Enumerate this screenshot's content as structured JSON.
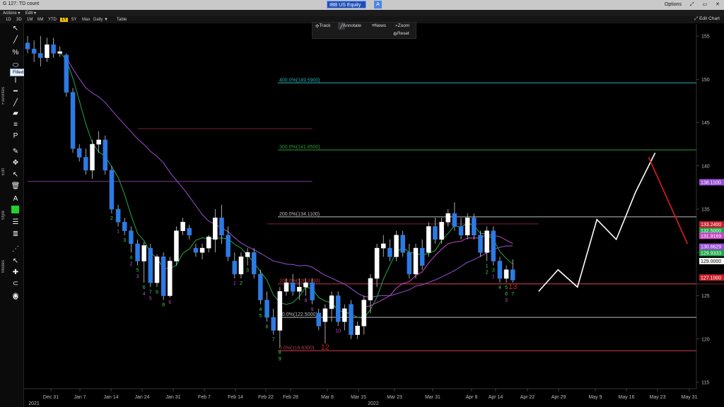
{
  "window": {
    "title": "G 127: TD count",
    "ticker": "IBB US Equity",
    "ticker_badge": "A",
    "options": "Options",
    "controls": [
      "⤢",
      "▭",
      "✕"
    ]
  },
  "menu": {
    "items": [
      "Actions ▾",
      "Edit ▾"
    ]
  },
  "periods": {
    "items": [
      "1D",
      "3D",
      "1M",
      "6M",
      "YTD",
      "1Y",
      "5Y",
      "Max",
      "Daily ▼",
      "Table"
    ],
    "active": "1Y"
  },
  "edit_chart": "⤢ Edit Chart",
  "chart_buttons": {
    "track": "Track",
    "annotate": "Annotate",
    "news": "News",
    "zoom": "Zoom",
    "reset": "Reset"
  },
  "toolbar": {
    "tooltip": "Filled Oval",
    "labels": {
      "favorites": "Favorites",
      "edit": "Edit",
      "style": "Style",
      "modes": "Modes"
    }
  },
  "chart_data": {
    "type": "candlestick",
    "y_axis": {
      "min": 115,
      "max": 155,
      "ticks": [
        115,
        120,
        125,
        130,
        135,
        140,
        145,
        150,
        155
      ]
    },
    "x_axis": {
      "ticks": [
        "Dec 31",
        "Jan 7",
        "Jan 14",
        "Jan 24",
        "Jan 31",
        "Feb 7",
        "Feb 14",
        "Feb 22",
        "Feb 28",
        "Mar 8",
        "Mar 15",
        "Mar 23",
        "Mar 31",
        "Apr 8",
        "Apr 14",
        "Apr 22",
        "Apr 29",
        "May 9",
        "May 16",
        "May 23",
        "May 31"
      ],
      "years": [
        "2021",
        "2022"
      ]
    },
    "candles": [
      [
        154.2,
        155,
        153,
        153.5
      ],
      [
        153.5,
        154.5,
        152,
        153
      ],
      [
        153,
        155,
        151.5,
        152.5
      ],
      [
        152.5,
        154.8,
        152,
        154
      ],
      [
        154,
        154.8,
        152.5,
        153
      ],
      [
        153,
        153.8,
        152.6,
        153.2
      ],
      [
        152.8,
        153,
        148,
        148.5
      ],
      [
        148.5,
        149,
        141.5,
        142
      ],
      [
        142,
        142.5,
        140.5,
        141
      ],
      [
        141,
        142,
        139,
        139.5
      ],
      [
        139.5,
        143,
        138.5,
        142.5
      ],
      [
        142.5,
        144,
        141.5,
        143
      ],
      [
        143,
        143.5,
        139,
        139.5
      ],
      [
        139.5,
        140,
        134.5,
        135
      ],
      [
        135,
        135.5,
        133,
        133.5
      ],
      [
        133.5,
        134,
        132,
        132.5
      ],
      [
        132.5,
        133,
        130,
        131
      ],
      [
        131,
        131.5,
        128.5,
        129
      ],
      [
        129,
        131.2,
        126.5,
        130.8
      ],
      [
        130.5,
        131,
        126,
        126.5
      ],
      [
        126.5,
        129.8,
        126,
        129.5
      ],
      [
        129.5,
        130,
        124.5,
        125
      ],
      [
        125,
        129.5,
        124.8,
        129
      ],
      [
        129,
        133,
        128.5,
        132.5
      ],
      [
        132.5,
        134,
        132,
        133.5
      ],
      [
        132.8,
        133.2,
        131.5,
        132
      ],
      [
        130.5,
        131,
        129.5,
        130
      ],
      [
        130,
        131,
        129.2,
        130.5
      ],
      [
        130.5,
        132,
        130,
        131.8
      ],
      [
        131.5,
        135,
        130,
        134
      ],
      [
        134,
        135.5,
        131,
        132
      ],
      [
        132,
        133,
        129,
        129.5
      ],
      [
        129,
        130,
        127,
        127.5
      ],
      [
        127.5,
        130,
        127,
        129.5
      ],
      [
        129.5,
        130.5,
        128.5,
        130
      ],
      [
        130,
        130.5,
        127,
        127.5
      ],
      [
        127.5,
        128,
        124,
        124.5
      ],
      [
        124.5,
        125.5,
        122,
        122.5
      ],
      [
        122.5,
        123.5,
        120.5,
        121
      ],
      [
        121,
        126,
        119,
        125.5
      ],
      [
        125.5,
        127,
        125,
        126.5
      ],
      [
        126.5,
        127.5,
        125,
        125.5
      ],
      [
        125.5,
        127,
        124.5,
        126
      ],
      [
        126,
        127,
        125,
        126.5
      ],
      [
        126.5,
        127,
        124,
        124.5
      ],
      [
        123,
        123.5,
        121,
        121.5
      ],
      [
        122,
        124,
        119.5,
        123.5
      ],
      [
        123.5,
        125.5,
        122,
        125
      ],
      [
        125,
        125.5,
        121.5,
        122
      ],
      [
        122,
        124,
        121,
        123.5
      ],
      [
        124,
        124.5,
        120,
        120.5
      ],
      [
        120.5,
        122,
        120,
        121.5
      ],
      [
        121.5,
        125,
        120.5,
        124.5
      ],
      [
        124.5,
        127.5,
        123,
        127
      ],
      [
        127,
        131,
        126,
        130.5
      ],
      [
        130.5,
        132,
        129.5,
        131
      ],
      [
        130.5,
        131.5,
        129,
        129.5
      ],
      [
        129.5,
        132.5,
        129,
        132
      ],
      [
        132,
        132.5,
        129.5,
        130
      ],
      [
        130,
        131,
        127,
        127.5
      ],
      [
        127.5,
        131,
        127,
        130.5
      ],
      [
        130.5,
        131.5,
        128,
        128.5
      ],
      [
        130,
        133.5,
        129.5,
        133
      ],
      [
        133,
        134,
        131,
        131.5
      ],
      [
        131.5,
        134,
        131,
        133.5
      ],
      [
        133.5,
        135,
        133,
        134.5
      ],
      [
        134.5,
        135.8,
        132.5,
        133
      ],
      [
        133,
        134,
        131.5,
        132
      ],
      [
        132,
        134.5,
        131.5,
        134
      ],
      [
        134,
        134.5,
        131.5,
        132
      ],
      [
        132,
        132.5,
        129.5,
        130
      ],
      [
        130,
        133,
        129,
        132.5
      ],
      [
        132.5,
        133,
        128.5,
        129
      ],
      [
        129,
        129.5,
        126.5,
        127
      ],
      [
        127,
        128.5,
        126.5,
        128
      ],
      [
        128,
        129.2,
        126.5,
        126.8
      ]
    ],
    "fib_levels": [
      {
        "label": "400.0%(149.5900)",
        "value": 149.59,
        "color": "#2bb0b8"
      },
      {
        "label": "300.0%(141.8500)",
        "value": 141.85,
        "color": "#2a9a3a"
      },
      {
        "label": "200.0%(134.1100)",
        "value": 134.11,
        "color": "#bdbdbd"
      },
      {
        "label": "100.0%(126.3700)",
        "value": 126.37,
        "color": "#c0394a"
      },
      {
        "label": "50.0%(122.5000)",
        "value": 122.5,
        "color": "#bdbdbd"
      },
      {
        "label": "0.0%(118.6300)",
        "value": 118.63,
        "color": "#c0394a"
      }
    ],
    "price_tags": [
      {
        "label": "138.1100",
        "value": 138.11,
        "bg": "#9a4fd6",
        "fg": "#fff"
      },
      {
        "label": "133.2400",
        "value": 133.24,
        "bg": "#c81e2a",
        "fg": "#fff"
      },
      {
        "label": "132.5000",
        "value": 132.5,
        "bg": "#22a64a",
        "fg": "#fff"
      },
      {
        "label": "131.9169",
        "value": 131.9169,
        "bg": "#c846c8",
        "fg": "#fff"
      },
      {
        "label": "130.6629",
        "value": 130.6629,
        "bg": "#9a4fd6",
        "fg": "#fff"
      },
      {
        "label": "129.9333",
        "value": 129.9333,
        "bg": "#22a64a",
        "fg": "#fff"
      },
      {
        "label": "129.0000",
        "value": 129.0,
        "bg": "#ffffff",
        "fg": "#000"
      },
      {
        "label": "127.1000",
        "value": 127.1,
        "bg": "#c81e2a",
        "fg": "#fff"
      }
    ],
    "horizontal_lines": [
      {
        "value": 144.3,
        "from": 17,
        "to": 44,
        "color": "#7a2030"
      },
      {
        "value": 138.2,
        "from": 0,
        "to": 44,
        "color": "#7a3a9a"
      },
      {
        "value": 133.3,
        "from": 37,
        "to": 79,
        "color": "#7a2030"
      },
      {
        "value": 126.37,
        "from": 57,
        "to": 109,
        "color": "#7a2030"
      }
    ],
    "projection": {
      "white": [
        [
          79,
          125.5
        ],
        [
          82,
          128
        ],
        [
          85,
          126
        ],
        [
          88,
          133.8
        ],
        [
          91,
          131.5
        ],
        [
          94,
          137
        ],
        [
          97,
          141.5
        ]
      ],
      "red": [
        [
          96,
          141
        ],
        [
          102,
          131
        ]
      ]
    },
    "td_counts": [
      {
        "i": 13,
        "text": "2",
        "color": "#3bd24b",
        "above": false
      },
      {
        "i": 14,
        "text": "1",
        "color": "#c846c8",
        "above": false
      },
      {
        "i": 15,
        "text": "3",
        "color": "#3bd24b",
        "above": false
      },
      {
        "i": 16,
        "text": "4",
        "color": "#3bd24b",
        "above": false
      },
      {
        "i": 17,
        "text": "5",
        "color": "#3bd24b",
        "above": false
      },
      {
        "i": 16,
        "text": "2",
        "color": "#c846c8",
        "above": false
      },
      {
        "i": 17,
        "text": "3",
        "color": "#c846c8",
        "above": false
      },
      {
        "i": 18,
        "text": "6",
        "color": "#3bd24b",
        "above": false
      },
      {
        "i": 18,
        "text": "4",
        "color": "#c846c8",
        "above": false
      },
      {
        "i": 19,
        "text": "7",
        "color": "#3bd24b",
        "above": false
      },
      {
        "i": 19,
        "text": "5",
        "color": "#c846c8",
        "above": false
      },
      {
        "i": 20,
        "text": "9",
        "color": "#3bd24b",
        "above": false
      },
      {
        "i": 21,
        "text": "8",
        "color": "#3bd24b",
        "above": false
      },
      {
        "i": 22,
        "text": "6",
        "color": "#c846c8",
        "above": false
      },
      {
        "i": 32,
        "text": "1",
        "color": "#c846c8",
        "above": false
      },
      {
        "i": 33,
        "text": "2",
        "color": "#3bd24b",
        "above": false
      },
      {
        "i": 34,
        "text": "3",
        "color": "#3bd24b",
        "above": false
      },
      {
        "i": 36,
        "text": "4",
        "color": "#3bd24b",
        "above": false
      },
      {
        "i": 36,
        "text": "5",
        "color": "#3bd24b",
        "above": false
      },
      {
        "i": 37,
        "text": "6",
        "color": "#3bd24b",
        "above": false
      },
      {
        "i": 38,
        "text": "7",
        "color": "#3bd24b",
        "above": false
      },
      {
        "i": 39,
        "text": "8",
        "color": "#3bd24b",
        "above": false
      },
      {
        "i": 39,
        "text": "9",
        "color": "#3bd24b",
        "above": false
      },
      {
        "i": 43,
        "text": "8",
        "color": "#c846c8",
        "above": false
      },
      {
        "i": 44,
        "text": "9",
        "color": "#c846c8",
        "above": false
      },
      {
        "i": 46,
        "text": "12",
        "color": "#c81e2a",
        "above": false
      },
      {
        "i": 48,
        "text": "10",
        "color": "#c846c8",
        "above": false
      },
      {
        "i": 71,
        "text": "1",
        "color": "#3bd24b",
        "above": false
      },
      {
        "i": 71,
        "text": "2",
        "color": "#3bd24b",
        "above": false
      },
      {
        "i": 72,
        "text": "3",
        "color": "#3bd24b",
        "above": false
      },
      {
        "i": 72,
        "text": "1",
        "color": "#c846c8",
        "above": false
      },
      {
        "i": 73,
        "text": "4",
        "color": "#3bd24b",
        "above": false
      },
      {
        "i": 74,
        "text": "5",
        "color": "#3bd24b",
        "above": false
      },
      {
        "i": 74,
        "text": "6",
        "color": "#3bd24b",
        "above": false
      },
      {
        "i": 75,
        "text": "13",
        "color": "#c81e2a",
        "above": false
      },
      {
        "i": 75,
        "text": "7",
        "color": "#3bd24b",
        "above": false
      },
      {
        "i": 74,
        "text": "3",
        "color": "#c846c8",
        "above": false
      }
    ]
  }
}
